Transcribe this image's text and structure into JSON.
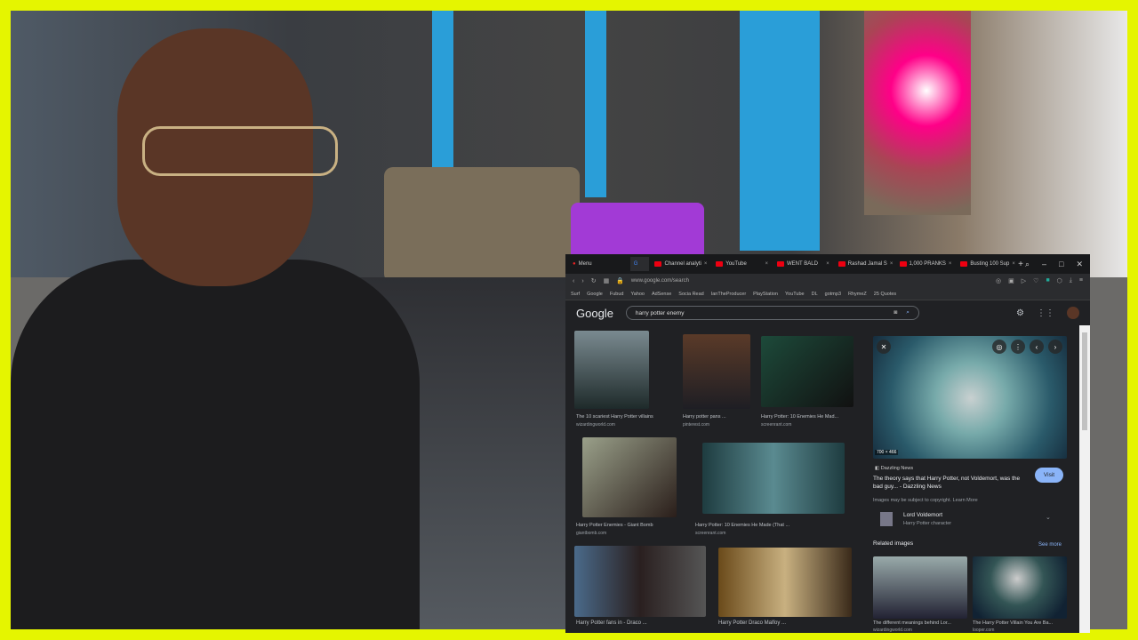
{
  "browser": {
    "menu_label": "Menu",
    "tabs": [
      {
        "label": "Channel analyti"
      },
      {
        "label": "YouTube"
      },
      {
        "label": "WENT BALD"
      },
      {
        "label": "Rashad Jamal S"
      },
      {
        "label": "1,000 PRANKS"
      },
      {
        "label": "Busting 100 Sup"
      }
    ],
    "url": "www.google.com/search",
    "bookmarks": [
      "Surf",
      "Google",
      "Fubud",
      "Yahoo",
      "AdSense",
      "Socia Read",
      "IanTheProducer",
      "PlayStation",
      "YouTube",
      "DL",
      "gotmp3",
      "RhymeZ",
      "25 Quotes"
    ]
  },
  "google": {
    "logo": "Google",
    "query": "harry potter enemy",
    "results": [
      {
        "title": "The 10 scariest Harry Potter villains",
        "source": "wizardingworld.com"
      },
      {
        "title": "Harry potter pans ...",
        "source": "pinterest.com"
      },
      {
        "title": "Harry Potter: 10 Enemies He Mad...",
        "source": "screenrant.com"
      },
      {
        "title": "Harry Potter Enemies - Giant Bomb",
        "source": "giantbomb.com"
      },
      {
        "title": "Harry Potter: 10 Enemies He Made (That ...",
        "source": "screenrant.com"
      },
      {
        "title": "Harry Potter fans in - Draco ...",
        "source": ""
      },
      {
        "title": "Harry Potter Draco Malfoy ...",
        "source": ""
      }
    ],
    "panel": {
      "size": "700 × 466",
      "site": "Dazzling News",
      "title": "The theory says that Harry Potter, not Voldemort, was the bad guy... - Dazzling News",
      "visit": "Visit",
      "copyright": "Images may be subject to copyright. Learn More",
      "entity_name": "Lord Voldemort",
      "entity_desc": "Harry Potter character",
      "related_label": "Related images",
      "see_more": "See more",
      "related": [
        {
          "title": "The different meanings behind Lor...",
          "source": "wizardingworld.com"
        },
        {
          "title": "The Harry Potter Villain You Are Ba...",
          "source": "looper.com"
        }
      ]
    }
  },
  "colors": {
    "frame": "#e5f500",
    "accent": "#8ab4f8"
  }
}
